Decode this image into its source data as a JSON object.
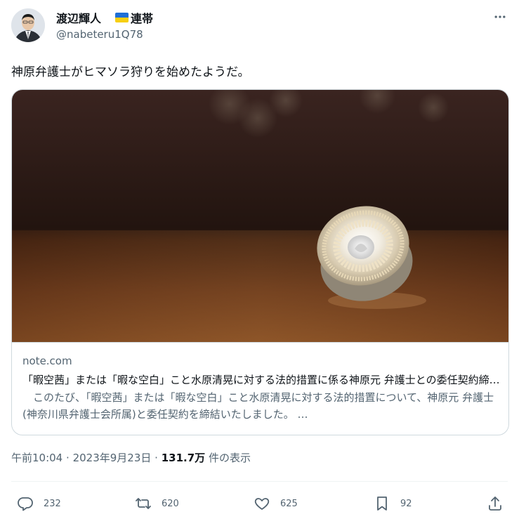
{
  "author": {
    "name": "渡辺輝人",
    "badge_label": "連帯",
    "flag_colors": [
      "#1f6fd6",
      "#f7cf12"
    ],
    "handle": "@nabeteru1Q78"
  },
  "menu": {
    "icon": "more-horizontal-icon"
  },
  "tweet": {
    "text": "神原弁護士がヒマソラ狩りを始めたようだ。"
  },
  "card": {
    "image_description_icon": "lawyer-badge-photo",
    "domain": "note.com",
    "title": "「暇空茜」または「暇な空白」こと水原清晃に対する法的措置に係る神原元 弁護士との委任契約締結のお知らせ",
    "description": "　このたび、「暇空茜」または「暇な空白」こと水原清晃に対する法的措置について、神原元 弁護士(神奈川県弁護士会所属)と委任契約を締結いたしました。 …"
  },
  "meta": {
    "time": "午前10:04",
    "separator": "·",
    "date": "2023年9月23日",
    "views_count": "131.7万",
    "views_label": "件の表示"
  },
  "actions": {
    "reply": {
      "icon": "reply-icon",
      "count": "232"
    },
    "retweet": {
      "icon": "retweet-icon",
      "count": "620"
    },
    "like": {
      "icon": "heart-icon",
      "count": "625"
    },
    "bookmark": {
      "icon": "bookmark-icon",
      "count": "92"
    },
    "share": {
      "icon": "share-icon"
    }
  }
}
